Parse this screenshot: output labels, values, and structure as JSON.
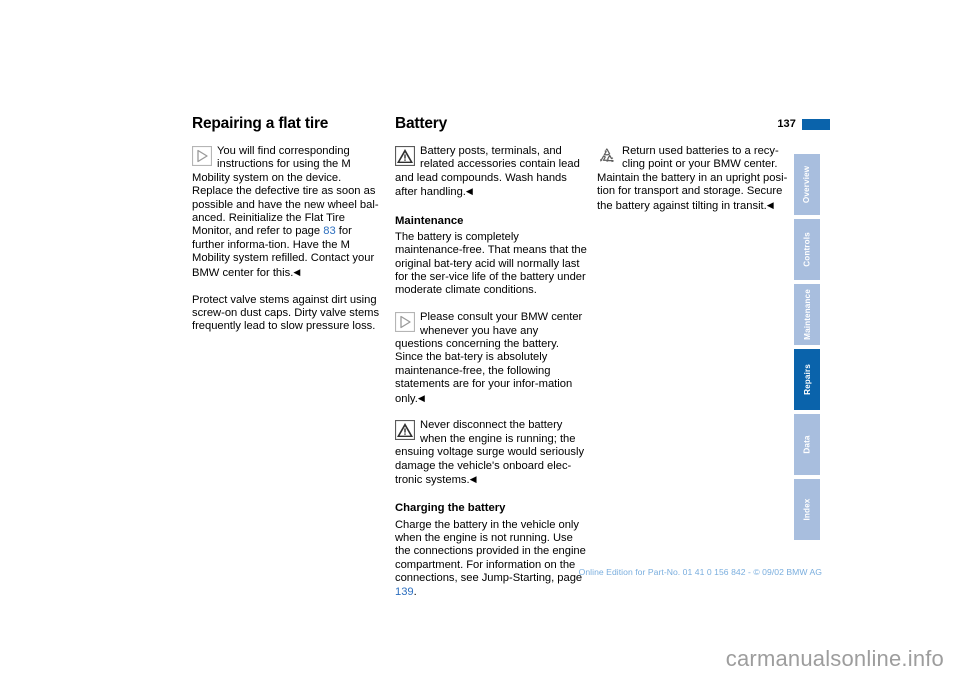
{
  "page": {
    "number": "137",
    "marker_color": "#0a63ab"
  },
  "columns": {
    "col1": {
      "title": "Repairing a flat tire",
      "note1": {
        "icon": "note-pointer-icon",
        "text": "You will find corresponding instructions for using the M Mobility system on the device. Replace the defective tire as soon as possible and have the new wheel bal-anced. Reinitialize the Flat Tire Monitor, and refer to page ",
        "link": "83",
        "text_after": " for further informa-tion. Have the M Mobility system refilled. Contact your BMW center for this.",
        "endmark": "◀"
      },
      "para1": "Protect valve stems against dirt using screw-on dust caps. Dirty valve stems frequently lead to slow pressure loss."
    },
    "col2": {
      "title": "Battery",
      "note1": {
        "icon": "warning-triangle-icon",
        "text": "Battery posts, terminals, and related accessories contain lead and lead compounds. Wash hands after handling.",
        "endmark": "◀"
      },
      "sub1": "Maintenance",
      "para1": "The battery is completely maintenance-free. That means that the original bat-tery acid will normally last for the ser-vice life of the battery under moderate climate conditions.",
      "note2": {
        "icon": "note-pointer-icon",
        "text": "Please consult your BMW center whenever you have any questions concerning the battery. Since the bat-tery is absolutely maintenance-free, the following statements are for your infor-mation only.",
        "endmark": "◀"
      },
      "note3": {
        "icon": "warning-triangle-icon",
        "text": "Never disconnect the battery when the engine is running; the ensuing voltage surge would seriously damage the vehicle's onboard elec-tronic systems.",
        "endmark": "◀"
      },
      "sub2": "Charging the battery",
      "para2_before": "Charge the battery in the vehicle only when the engine is not running. Use the connections provided in the engine compartment. For information on the connections, see Jump-Starting, page ",
      "para2_link": "139",
      "para2_after": "."
    },
    "col3": {
      "note1": {
        "icon": "recycling-icon",
        "text": "Return used batteries to a recy-cling point or your BMW center. Maintain the battery in an upright posi-tion for transport and storage. Secure the battery against tilting in transit.",
        "endmark": "◀"
      }
    }
  },
  "tabs": [
    {
      "label": "Overview",
      "active": false
    },
    {
      "label": "Controls",
      "active": false
    },
    {
      "label": "Maintenance",
      "active": false
    },
    {
      "label": "Repairs",
      "active": true
    },
    {
      "label": "Data",
      "active": false
    },
    {
      "label": "Index",
      "active": false
    }
  ],
  "footer": {
    "text": "Online Edition for Part-No. 01 41 0 156 842 - © 09/02 BMW AG"
  },
  "watermark": {
    "text": "carmanualsonline.info"
  },
  "colors": {
    "accent_blue": "#0a63ab",
    "tab_inactive": "#a8bede",
    "link_blue": "#2d6fbf",
    "footer_blue": "#7aaede",
    "watermark_gray": "#9d9d9d"
  }
}
